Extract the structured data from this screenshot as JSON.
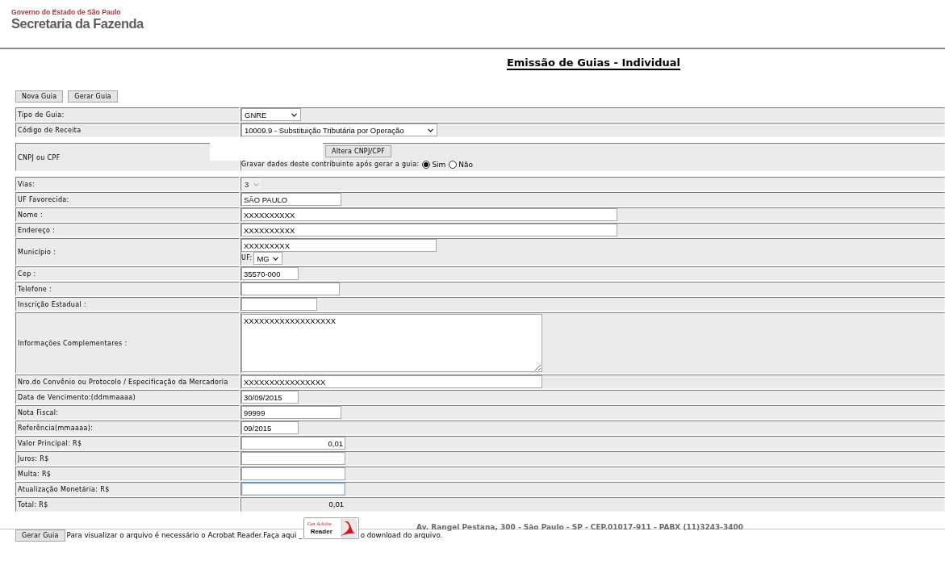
{
  "header": {
    "government": "Governo do Estado de São Paulo",
    "department": "Secretaria da Fazenda"
  },
  "title": "Emissão de Guias - Individual",
  "toolbar_buttons": [
    "Nova Guia",
    "Gerar Guia"
  ],
  "form_groups": [
    {
      "rows": [
        {
          "kind": "select",
          "label": "Tipo de Guia:",
          "value": "GNRE",
          "disabled": false
        },
        {
          "kind": "select",
          "label": "Código de Receita",
          "value": "10009.9 - Substituição Tributária por Operação",
          "disabled": false
        }
      ]
    },
    {
      "rows": [
        {
          "kind": "taxpayer",
          "label": "CNPJ ou CPF",
          "button": "Altera CNPJ/CPF",
          "save_prompt": "Gravar dados deste contribuinte após gerar a guia:",
          "options": [
            {
              "label": "Sim",
              "selected": true
            },
            {
              "label": "Não",
              "selected": false
            }
          ]
        }
      ]
    },
    {
      "rows": [
        {
          "kind": "select",
          "label": "Vias:",
          "value": "3",
          "disabled": true
        },
        {
          "kind": "text",
          "label": "UF Favorecida:",
          "value": "SÃO PAULO",
          "focused": false
        },
        {
          "kind": "text",
          "label": "Nome :",
          "value": "XXXXXXXXXX",
          "focused": false
        },
        {
          "kind": "text",
          "label": "Endereço :",
          "value": "XXXXXXXXXX",
          "focused": false
        },
        {
          "kind": "city",
          "label": "Município :",
          "value": "XXXXXXXXX",
          "focused": false,
          "state_label": "UF:",
          "state_value": "MG"
        },
        {
          "kind": "text",
          "label": "Cep :",
          "value": "35570-000",
          "focused": false
        },
        {
          "kind": "text",
          "label": "Telefone :",
          "focused": false
        },
        {
          "kind": "text",
          "label": "Inscrição Estadual :",
          "focused": false
        },
        {
          "kind": "textarea",
          "label": "Informações Complementares :",
          "value": "XXXXXXXXXXXXXXXXXX",
          "focused": false
        },
        {
          "kind": "text",
          "label": "Nro.do Convênio ou Protocolo / Especificação da Mercadoria",
          "value": "XXXXXXXXXXXXXXXX",
          "focused": false
        },
        {
          "kind": "text",
          "label": "Data de Vencimento:(ddmmaaaa)",
          "value": "30/09/2015",
          "focused": false
        },
        {
          "kind": "text",
          "label": "Nota Fiscal:",
          "value": "99999",
          "focused": false
        },
        {
          "kind": "text",
          "label": "Referência(mmaaaa):",
          "value": "09/2015",
          "focused": false
        },
        {
          "kind": "money",
          "label": "Valor Principal: R$",
          "value": "0,01",
          "focused": false
        },
        {
          "kind": "money",
          "label": "Juros: R$",
          "focused": false
        },
        {
          "kind": "money",
          "label": "Multa: R$",
          "focused": false
        },
        {
          "kind": "money",
          "label": "Atualização Monetária: R$",
          "focused": true
        },
        {
          "kind": "total",
          "label": "Total: R$",
          "value": "0,01"
        }
      ]
    }
  ],
  "footer": {
    "address": "Av. Rangel Pestana, 300 - São Paulo - SP - CEP.01017-911 - PABX (11)3243-3400",
    "button": "Gerar Guia",
    "reader_prompt": "Para visualizar o arquivo é necessário o Acrobat Reader.Faça aqui _",
    "badge": {
      "line_1": "Get Adobe",
      "line_2": "Reader"
    },
    "download_suffix": "o download do arquivo."
  }
}
